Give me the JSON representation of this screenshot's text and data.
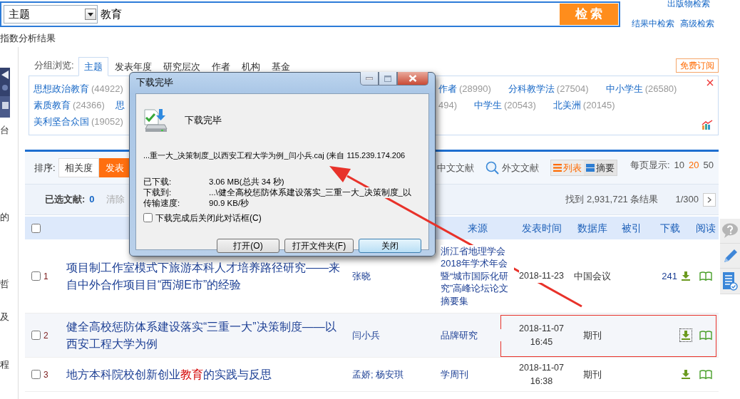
{
  "search": {
    "field": "主题",
    "query": "教育",
    "button": "检 索",
    "links": [
      "出版物检索",
      "结果中检索",
      "高级检索"
    ]
  },
  "index_link": "指数分析结果",
  "sidebar": {
    "caption": "台",
    "fragments": [
      "的",
      "哲",
      "及",
      "程"
    ]
  },
  "group_browse": {
    "label": "分组浏览:",
    "subscribe": "免费订阅",
    "tabs": [
      {
        "label": "主题",
        "selected": true
      },
      {
        "label": "发表年度",
        "selected": false
      },
      {
        "label": "研究层次",
        "selected": false
      },
      {
        "label": "作者",
        "selected": false
      },
      {
        "label": "机构",
        "selected": false
      },
      {
        "label": "基金",
        "selected": false
      }
    ],
    "subject_rows": [
      {
        "left": [
          {
            "name": "思想政治教育",
            "count": "(44922)"
          }
        ],
        "right": [
          {
            "name": "作者",
            "count": "(28990)"
          },
          {
            "name": "分科教学法",
            "count": "(27504)"
          },
          {
            "name": "中小学生",
            "count": "(26580)"
          }
        ]
      },
      {
        "left": [
          {
            "name": "素质教育",
            "count": "(24366)"
          },
          {
            "name": "思"
          }
        ],
        "right": [
          {
            "count": "494)"
          },
          {
            "name": "中学生",
            "count": "(20543)"
          },
          {
            "name": "北美洲",
            "count": "(20145)"
          }
        ]
      },
      {
        "left": [
          {
            "name": "美利坚合众国",
            "count": "(19052)"
          }
        ]
      }
    ]
  },
  "results": {
    "sort_label": "排序:",
    "sort_options": [
      {
        "label": "相关度",
        "selected": false
      },
      {
        "label": "发表",
        "selected": true
      }
    ],
    "languages": [
      {
        "label": "中文文献",
        "kind": "plain"
      },
      {
        "label": "外文文献",
        "kind": "foreign"
      }
    ],
    "views": [
      {
        "label": "列表",
        "kind": "list",
        "selected": true
      },
      {
        "label": "摘要",
        "kind": "abstract",
        "selected": false
      }
    ],
    "page_size_label": "每页显示:",
    "page_sizes": [
      {
        "label": "10",
        "selected": false
      },
      {
        "label": "20",
        "selected": true
      },
      {
        "label": "50",
        "selected": false
      }
    ],
    "selected_label": "已选文献:",
    "selected_count": "0",
    "clear": "清除",
    "found": "找到 2,931,721 条结果",
    "page": "1/300"
  },
  "table": {
    "all_checked": false,
    "columns": [
      "来源",
      "发表时间",
      "数据库",
      "被引",
      "下载",
      "阅读"
    ],
    "rows": [
      {
        "number": "1",
        "title": "项目制工作室模式下旅游本科人才培养路径研究——来自中外合作项目目“西湖E市”的经验",
        "author": "张晓",
        "source": "浙江省地理学会2018年学术年会暨“城市国际化研究”高峰论坛论文摘要集",
        "date": "2018-11-23",
        "database": "中国会议",
        "downloads": "241",
        "checked": false,
        "highlighted": false,
        "download_focused": false
      },
      {
        "number": "2",
        "title": "健全高校惩防体系建设落实“三重一大”决策制度——以西安工程大学为例",
        "author": "闫小兵",
        "source": "品牌研究",
        "date": "2018-11-07 16:45",
        "database": "期刊",
        "checked": false,
        "highlighted": true,
        "download_focused": true
      },
      {
        "number": "3",
        "title": "地方本科院校创新创业**教育**的实践与反思",
        "author": "孟娇; 杨安琪",
        "source": "学周刊",
        "date": "2018-11-07 16:38",
        "database": "期刊",
        "checked": false,
        "highlighted": false,
        "download_focused": false
      }
    ]
  },
  "dialog": {
    "title": "下载完毕",
    "heading": "下载完毕",
    "file": "...重一大_决策制度_以西安工程大学为例_闫小兵.caj (来自 115.239.174.206",
    "details": [
      {
        "label": "已下载:",
        "value": "3.06 MB(总共 34 秒)"
      },
      {
        "label": "下载到:",
        "value": "...\\健全高校惩防体系建设落实_三重一大_决策制度_以"
      },
      {
        "label": "传输速度:",
        "value": "90.9 KB/秒"
      }
    ],
    "close_when_done": {
      "label": "下载完成后关闭此对话框(C)",
      "checked": false
    },
    "buttons": [
      {
        "label": "打开(O)",
        "default": false
      },
      {
        "label": "打开文件夹(F)",
        "default": false
      },
      {
        "label": "关闭",
        "default": true
      }
    ]
  }
}
